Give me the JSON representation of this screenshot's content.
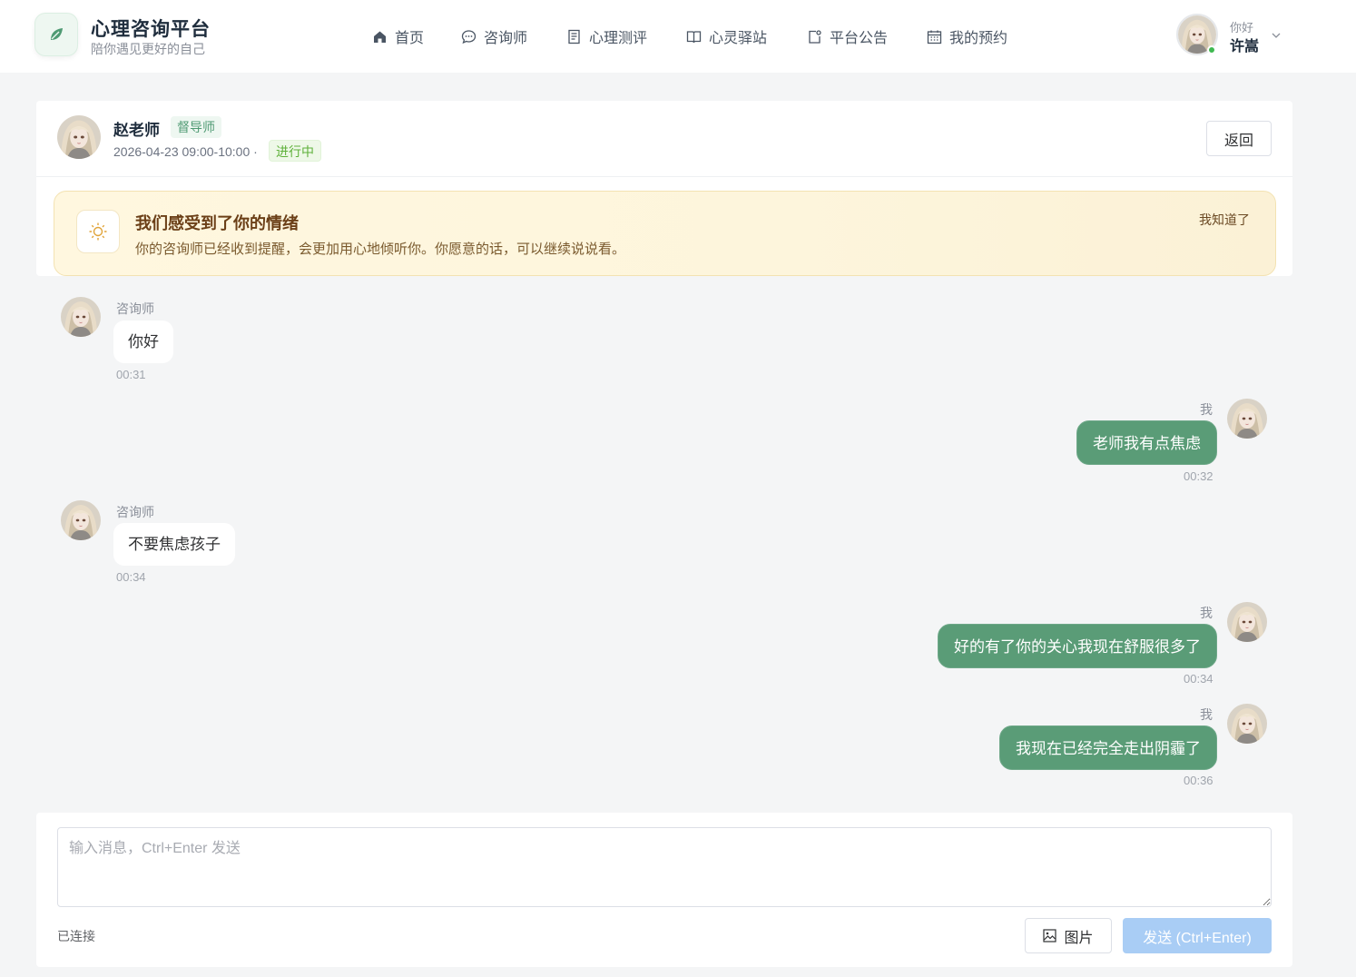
{
  "brand": {
    "title": "心理咨询平台",
    "subtitle": "陪你遇见更好的自己"
  },
  "nav": {
    "items": [
      {
        "label": "首页",
        "icon": "home-icon"
      },
      {
        "label": "咨询师",
        "icon": "chat-icon"
      },
      {
        "label": "心理测评",
        "icon": "document-icon"
      },
      {
        "label": "心灵驿站",
        "icon": "book-icon"
      },
      {
        "label": "平台公告",
        "icon": "announcement-icon"
      },
      {
        "label": "我的预约",
        "icon": "calendar-icon"
      }
    ]
  },
  "user": {
    "greeting": "你好",
    "name": "许嵩",
    "status": "online"
  },
  "session": {
    "counselor_name": "赵老师",
    "counselor_role": "督导师",
    "time": "2026-04-23 09:00-10:00 ·",
    "status": "进行中",
    "back_label": "返回"
  },
  "notice": {
    "title": "我们感受到了你的情绪",
    "text": "你的咨询师已经收到提醒，会更加用心地倾听你。你愿意的话，可以继续说说看。",
    "ack_label": "我知道了",
    "icon": "sun-icon"
  },
  "messages": [
    {
      "side": "in",
      "sender": "咨询师",
      "text": "你好",
      "time": "00:31"
    },
    {
      "side": "out",
      "sender": "我",
      "text": "老师我有点焦虑",
      "time": "00:32"
    },
    {
      "side": "in",
      "sender": "咨询师",
      "text": "不要焦虑孩子",
      "time": "00:34"
    },
    {
      "side": "out",
      "sender": "我",
      "text": "好的有了你的关心我现在舒服很多了",
      "time": "00:34"
    },
    {
      "side": "out",
      "sender": "我",
      "text": "我现在已经完全走出阴霾了",
      "time": "00:36"
    }
  ],
  "composer": {
    "placeholder": "输入消息，Ctrl+Enter 发送",
    "value": "",
    "connection_status": "已连接",
    "image_label": "图片",
    "send_label": "发送 (Ctrl+Enter)"
  },
  "colors": {
    "accent_green": "#5a9c77",
    "send_disabled": "#a9cdf5",
    "notice_bg": "#fff7df",
    "status_green": "#5fb13b"
  }
}
